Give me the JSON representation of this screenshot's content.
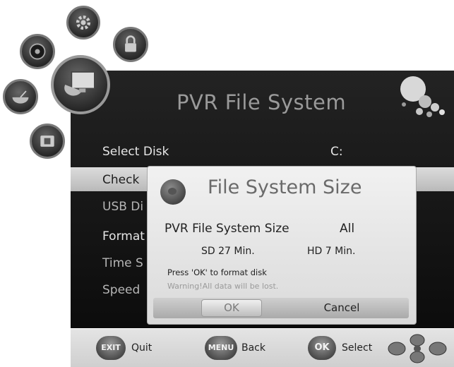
{
  "screen": {
    "title": "PVR File System"
  },
  "menu": {
    "items": [
      {
        "label": "Select Disk"
      },
      {
        "label": "Check"
      },
      {
        "label": "USB Di"
      },
      {
        "label": "Format"
      },
      {
        "label": "Time S"
      },
      {
        "label": "Speed"
      }
    ],
    "select_disk_value": "C:",
    "highlighted_index": 1
  },
  "dialog": {
    "title": "File System Size",
    "size_label": "PVR File System Size",
    "size_value": "All",
    "sd_time": "SD 27 Min.",
    "hd_time": "HD 7 Min.",
    "press_text": "Press 'OK' to format disk",
    "warning_text": "Warning!All data will be lost.",
    "ok_label": "OK",
    "cancel_label": "Cancel"
  },
  "hints": [
    {
      "button": "EXIT",
      "label": "Quit"
    },
    {
      "button": "MENU",
      "label": "Back"
    },
    {
      "button": "OK",
      "label": "Select"
    }
  ],
  "categories": [
    {
      "icon": "settings-icon"
    },
    {
      "icon": "lock-icon"
    },
    {
      "icon": "media-icon"
    },
    {
      "icon": "satellite-dish-icon"
    },
    {
      "icon": "tv-monitor-icon"
    },
    {
      "icon": "usb-device-icon"
    }
  ]
}
